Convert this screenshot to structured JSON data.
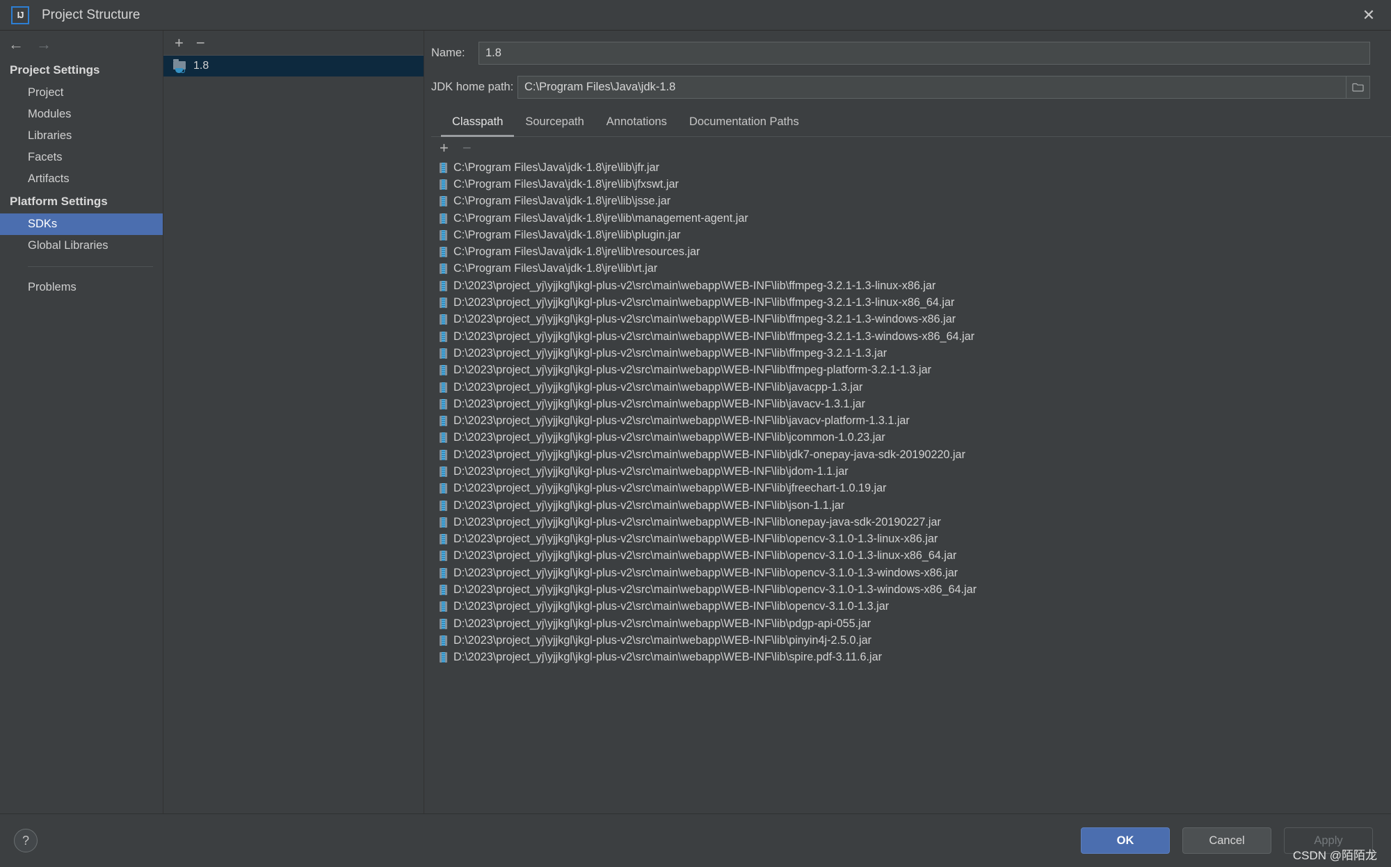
{
  "window": {
    "title": "Project Structure",
    "logo_text": "IJ",
    "close_icon": "close-icon"
  },
  "sidebar": {
    "back_icon": "arrow-left-icon",
    "forward_icon": "arrow-right-icon",
    "groups": [
      {
        "title": "Project Settings",
        "items": [
          {
            "label": "Project",
            "selected": false
          },
          {
            "label": "Modules",
            "selected": false
          },
          {
            "label": "Libraries",
            "selected": false
          },
          {
            "label": "Facets",
            "selected": false
          },
          {
            "label": "Artifacts",
            "selected": false
          }
        ]
      },
      {
        "title": "Platform Settings",
        "items": [
          {
            "label": "SDKs",
            "selected": true
          },
          {
            "label": "Global Libraries",
            "selected": false
          }
        ]
      }
    ],
    "problems_label": "Problems"
  },
  "sdk_panel": {
    "add_icon": "plus-icon",
    "remove_icon": "minus-icon",
    "items": [
      {
        "label": "1.8",
        "icon": "folder-java-icon",
        "selected": true
      }
    ]
  },
  "detail": {
    "name_label": "Name:",
    "name_value": "1.8",
    "jdk_path_label": "JDK home path:",
    "jdk_path_value": "C:\\Program Files\\Java\\jdk-1.8",
    "browse_icon": "folder-browse-icon",
    "tabs": [
      {
        "label": "Classpath",
        "active": true
      },
      {
        "label": "Sourcepath",
        "active": false
      },
      {
        "label": "Annotations",
        "active": false
      },
      {
        "label": "Documentation Paths",
        "active": false
      }
    ],
    "classpath_toolbar": {
      "add_icon": "plus-icon",
      "remove_icon": "minus-icon"
    },
    "classpath_entries": [
      "C:\\Program Files\\Java\\jdk-1.8\\jre\\lib\\jfr.jar",
      "C:\\Program Files\\Java\\jdk-1.8\\jre\\lib\\jfxswt.jar",
      "C:\\Program Files\\Java\\jdk-1.8\\jre\\lib\\jsse.jar",
      "C:\\Program Files\\Java\\jdk-1.8\\jre\\lib\\management-agent.jar",
      "C:\\Program Files\\Java\\jdk-1.8\\jre\\lib\\plugin.jar",
      "C:\\Program Files\\Java\\jdk-1.8\\jre\\lib\\resources.jar",
      "C:\\Program Files\\Java\\jdk-1.8\\jre\\lib\\rt.jar",
      "D:\\2023\\project_yj\\yjjkgl\\jkgl-plus-v2\\src\\main\\webapp\\WEB-INF\\lib\\ffmpeg-3.2.1-1.3-linux-x86.jar",
      "D:\\2023\\project_yj\\yjjkgl\\jkgl-plus-v2\\src\\main\\webapp\\WEB-INF\\lib\\ffmpeg-3.2.1-1.3-linux-x86_64.jar",
      "D:\\2023\\project_yj\\yjjkgl\\jkgl-plus-v2\\src\\main\\webapp\\WEB-INF\\lib\\ffmpeg-3.2.1-1.3-windows-x86.jar",
      "D:\\2023\\project_yj\\yjjkgl\\jkgl-plus-v2\\src\\main\\webapp\\WEB-INF\\lib\\ffmpeg-3.2.1-1.3-windows-x86_64.jar",
      "D:\\2023\\project_yj\\yjjkgl\\jkgl-plus-v2\\src\\main\\webapp\\WEB-INF\\lib\\ffmpeg-3.2.1-1.3.jar",
      "D:\\2023\\project_yj\\yjjkgl\\jkgl-plus-v2\\src\\main\\webapp\\WEB-INF\\lib\\ffmpeg-platform-3.2.1-1.3.jar",
      "D:\\2023\\project_yj\\yjjkgl\\jkgl-plus-v2\\src\\main\\webapp\\WEB-INF\\lib\\javacpp-1.3.jar",
      "D:\\2023\\project_yj\\yjjkgl\\jkgl-plus-v2\\src\\main\\webapp\\WEB-INF\\lib\\javacv-1.3.1.jar",
      "D:\\2023\\project_yj\\yjjkgl\\jkgl-plus-v2\\src\\main\\webapp\\WEB-INF\\lib\\javacv-platform-1.3.1.jar",
      "D:\\2023\\project_yj\\yjjkgl\\jkgl-plus-v2\\src\\main\\webapp\\WEB-INF\\lib\\jcommon-1.0.23.jar",
      "D:\\2023\\project_yj\\yjjkgl\\jkgl-plus-v2\\src\\main\\webapp\\WEB-INF\\lib\\jdk7-onepay-java-sdk-20190220.jar",
      "D:\\2023\\project_yj\\yjjkgl\\jkgl-plus-v2\\src\\main\\webapp\\WEB-INF\\lib\\jdom-1.1.jar",
      "D:\\2023\\project_yj\\yjjkgl\\jkgl-plus-v2\\src\\main\\webapp\\WEB-INF\\lib\\jfreechart-1.0.19.jar",
      "D:\\2023\\project_yj\\yjjkgl\\jkgl-plus-v2\\src\\main\\webapp\\WEB-INF\\lib\\json-1.1.jar",
      "D:\\2023\\project_yj\\yjjkgl\\jkgl-plus-v2\\src\\main\\webapp\\WEB-INF\\lib\\onepay-java-sdk-20190227.jar",
      "D:\\2023\\project_yj\\yjjkgl\\jkgl-plus-v2\\src\\main\\webapp\\WEB-INF\\lib\\opencv-3.1.0-1.3-linux-x86.jar",
      "D:\\2023\\project_yj\\yjjkgl\\jkgl-plus-v2\\src\\main\\webapp\\WEB-INF\\lib\\opencv-3.1.0-1.3-linux-x86_64.jar",
      "D:\\2023\\project_yj\\yjjkgl\\jkgl-plus-v2\\src\\main\\webapp\\WEB-INF\\lib\\opencv-3.1.0-1.3-windows-x86.jar",
      "D:\\2023\\project_yj\\yjjkgl\\jkgl-plus-v2\\src\\main\\webapp\\WEB-INF\\lib\\opencv-3.1.0-1.3-windows-x86_64.jar",
      "D:\\2023\\project_yj\\yjjkgl\\jkgl-plus-v2\\src\\main\\webapp\\WEB-INF\\lib\\opencv-3.1.0-1.3.jar",
      "D:\\2023\\project_yj\\yjjkgl\\jkgl-plus-v2\\src\\main\\webapp\\WEB-INF\\lib\\pdgp-api-055.jar",
      "D:\\2023\\project_yj\\yjjkgl\\jkgl-plus-v2\\src\\main\\webapp\\WEB-INF\\lib\\pinyin4j-2.5.0.jar",
      "D:\\2023\\project_yj\\yjjkgl\\jkgl-plus-v2\\src\\main\\webapp\\WEB-INF\\lib\\spire.pdf-3.11.6.jar"
    ]
  },
  "footer": {
    "help_label": "?",
    "ok_label": "OK",
    "cancel_label": "Cancel",
    "apply_label": "Apply",
    "watermark": "CSDN @陌陌龙"
  },
  "colors": {
    "accent": "#4b6eaf",
    "selection": "#0d293e",
    "background": "#3c3f41",
    "jar_icon": "#3592c4"
  }
}
